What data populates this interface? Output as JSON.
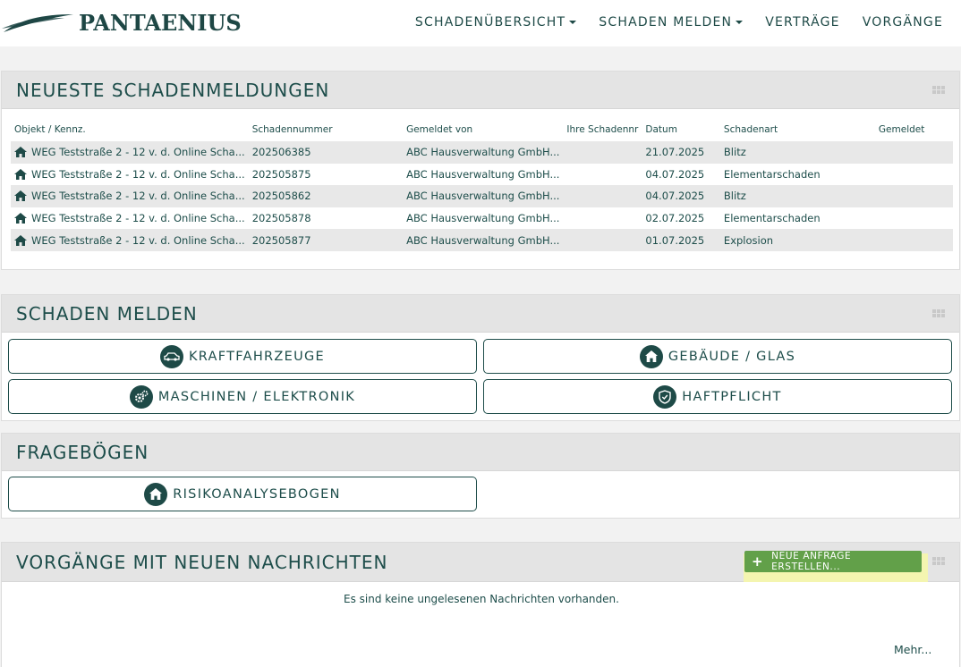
{
  "brand": {
    "name": "PANTAENIUS"
  },
  "nav": [
    {
      "label": "SCHADENÜBERSICHT",
      "dropdown": true
    },
    {
      "label": "SCHADEN MELDEN",
      "dropdown": true
    },
    {
      "label": "VERTRÄGE",
      "dropdown": false
    },
    {
      "label": "VORGÄNGE",
      "dropdown": false
    }
  ],
  "claims_panel": {
    "title": "NEUESTE SCHADENMELDUNGEN",
    "columns": [
      "Objekt / Kennz.",
      "Schadennummer",
      "Gemeldet von",
      "Ihre Schadennr",
      "Datum",
      "Schadenart",
      "Gemeldet"
    ],
    "rows": [
      {
        "object": "WEG Teststraße 2 - 12 v. d. Online Scha...",
        "number": "202506385",
        "reporter": "ABC Hausverwaltung GmbH...",
        "own_number": "",
        "date": "21.07.2025",
        "type": "Blitz",
        "reported": ""
      },
      {
        "object": "WEG Teststraße 2 - 12 v. d. Online Scha...",
        "number": "202505875",
        "reporter": "ABC Hausverwaltung GmbH...",
        "own_number": "",
        "date": "04.07.2025",
        "type": "Elementarschaden",
        "reported": ""
      },
      {
        "object": "WEG Teststraße 2 - 12 v. d. Online Scha...",
        "number": "202505862",
        "reporter": "ABC Hausverwaltung GmbH...",
        "own_number": "",
        "date": "04.07.2025",
        "type": "Blitz",
        "reported": ""
      },
      {
        "object": "WEG Teststraße 2 - 12 v. d. Online Scha...",
        "number": "202505878",
        "reporter": "ABC Hausverwaltung GmbH...",
        "own_number": "",
        "date": "02.07.2025",
        "type": "Elementarschaden",
        "reported": ""
      },
      {
        "object": "WEG Teststraße 2 - 12 v. d. Online Scha...",
        "number": "202505877",
        "reporter": "ABC Hausverwaltung GmbH...",
        "own_number": "",
        "date": "01.07.2025",
        "type": "Explosion",
        "reported": ""
      }
    ]
  },
  "report_panel": {
    "title": "SCHADEN MELDEN",
    "buttons": [
      {
        "label": "KRAFTFAHRZEUGE",
        "icon": "car-icon"
      },
      {
        "label": "GEBÄUDE / GLAS",
        "icon": "house-icon"
      },
      {
        "label": "MASCHINEN / ELEKTRONIK",
        "icon": "gears-icon"
      },
      {
        "label": "HAFTPFLICHT",
        "icon": "shield-icon"
      }
    ]
  },
  "questionnaires_panel": {
    "title": "FRAGEBÖGEN",
    "buttons": [
      {
        "label": "RISIKOANALYSEBOGEN",
        "icon": "house-icon"
      }
    ]
  },
  "messages_panel": {
    "title": "VORGÄNGE MIT NEUEN NACHRICHTEN",
    "new_request_label": "NEUE ANFRAGE ERSTELLEN...",
    "empty_text": "Es sind keine ungelesenen Nachrichten vorhanden.",
    "more_label": "Mehr..."
  },
  "colors": {
    "primary": "#1e4a47",
    "accent_green": "#62a049",
    "highlight": "#f4f5b0",
    "header_bg": "#e4e4e4"
  }
}
